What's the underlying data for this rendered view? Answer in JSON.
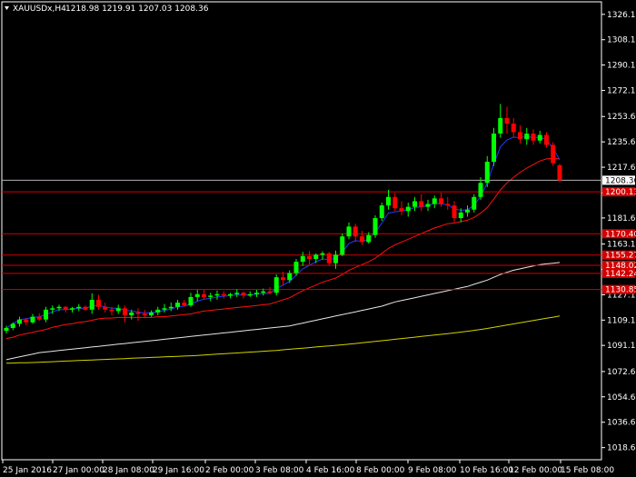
{
  "header": {
    "symbol": "XAUUSDx,H4",
    "ohlc": "1218.98 1219.91 1207.03 1208.36"
  },
  "colors": {
    "background": "#000000",
    "frame": "#ffffff",
    "bull": "#00ff00",
    "bear": "#ff0000",
    "ema_fast": "#1e3cff",
    "ema_mid": "#ff1010",
    "sma_slow": "#e6e6e6",
    "sma_vslow": "#d2d200",
    "level_line": "#d40000",
    "level_label_bg": "#d40000",
    "current_line": "#b0b0b0"
  },
  "chart_data": {
    "type": "candlestick",
    "symbol": "XAUUSDx",
    "timeframe": "H4",
    "ylim": [
      1010,
      1335
    ],
    "y_ticks": [
      "1326.10",
      "1308.10",
      "1290.15",
      "1272.10",
      "1253.60",
      "1235.60",
      "1217.60",
      "1199.55",
      "1181.60",
      "1163.10",
      "1145.15",
      "1127.10",
      "1109.10",
      "1091.15",
      "1072.60",
      "1054.65",
      "1036.60",
      "1018.60"
    ],
    "x_ticks": [
      "25 Jan 2016",
      "27 Jan 00:00",
      "28 Jan 08:00",
      "29 Jan 16:00",
      "2 Feb 00:00",
      "3 Feb 08:00",
      "4 Feb 16:00",
      "8 Feb 00:00",
      "9 Feb 08:00",
      "10 Feb 16:00",
      "12 Feb 00:00",
      "15 Feb 08:00"
    ],
    "candles": [
      [
        1101.5,
        1105,
        1099.5,
        1103.5
      ],
      [
        1103.5,
        1107.5,
        1102,
        1106.5
      ],
      [
        1106.5,
        1111.5,
        1104.5,
        1109.5
      ],
      [
        1109.5,
        1110.5,
        1105.5,
        1107.5
      ],
      [
        1107.5,
        1113.5,
        1106.5,
        1111.5
      ],
      [
        1111.5,
        1114,
        1108.5,
        1109.5
      ],
      [
        1109.5,
        1118.5,
        1107.5,
        1116.5
      ],
      [
        1116.5,
        1119.5,
        1113.5,
        1117.5
      ],
      [
        1117.5,
        1120,
        1115.5,
        1118.5
      ],
      [
        1118.5,
        1119,
        1114.5,
        1116.5
      ],
      [
        1116.5,
        1118.5,
        1114.5,
        1117.5
      ],
      [
        1117.5,
        1120.5,
        1115.5,
        1118.5
      ],
      [
        1118.5,
        1119.5,
        1115.5,
        1116.5
      ],
      [
        1116.5,
        1128,
        1113.5,
        1123.5
      ],
      [
        1123.5,
        1127,
        1116.5,
        1118.5
      ],
      [
        1118.5,
        1121.5,
        1114.5,
        1116.5
      ],
      [
        1116.5,
        1118.5,
        1112.5,
        1115.5
      ],
      [
        1115.5,
        1120,
        1113.5,
        1117.5
      ],
      [
        1117.5,
        1119.5,
        1107.5,
        1112.5
      ],
      [
        1112.5,
        1116.5,
        1109.5,
        1114.5
      ],
      [
        1114.5,
        1117.5,
        1108.5,
        1113.5
      ],
      [
        1113.5,
        1116.5,
        1110.5,
        1112.5
      ],
      [
        1112.5,
        1116,
        1111.5,
        1114.5
      ],
      [
        1114.5,
        1118.5,
        1112.5,
        1116.5
      ],
      [
        1116.5,
        1120.5,
        1114.5,
        1117.5
      ],
      [
        1117.5,
        1121.5,
        1115.5,
        1118.5
      ],
      [
        1118.5,
        1123.5,
        1116.5,
        1121.5
      ],
      [
        1121.5,
        1123.5,
        1118.5,
        1119.5
      ],
      [
        1119.5,
        1128.5,
        1118.5,
        1125.5
      ],
      [
        1125.5,
        1130.5,
        1122.5,
        1127.5
      ],
      [
        1127.5,
        1130.5,
        1123.5,
        1125.5
      ],
      [
        1125.5,
        1128.5,
        1122.5,
        1126.5
      ],
      [
        1126.5,
        1130,
        1123.5,
        1127.5
      ],
      [
        1127.5,
        1129.5,
        1124.5,
        1126.5
      ],
      [
        1126.5,
        1128.5,
        1124.5,
        1127.5
      ],
      [
        1127.5,
        1131,
        1125.5,
        1128.5
      ],
      [
        1128.5,
        1129.5,
        1124.5,
        1126.5
      ],
      [
        1126.5,
        1129.5,
        1125.5,
        1127.5
      ],
      [
        1127.5,
        1130.5,
        1125.5,
        1128.5
      ],
      [
        1128.5,
        1131.5,
        1126.5,
        1129.5
      ],
      [
        1129.5,
        1132.5,
        1127.5,
        1128.5
      ],
      [
        1128.5,
        1141.5,
        1126.5,
        1139.5
      ],
      [
        1139.5,
        1143.5,
        1133.5,
        1137.5
      ],
      [
        1137.5,
        1144.5,
        1135.5,
        1142.5
      ],
      [
        1142.5,
        1152.5,
        1140.5,
        1150.5
      ],
      [
        1150.5,
        1157.5,
        1147.5,
        1154.5
      ],
      [
        1154.5,
        1158,
        1148.5,
        1152.5
      ],
      [
        1152.5,
        1156.5,
        1149.5,
        1155.5
      ],
      [
        1155.5,
        1158,
        1152,
        1156.5
      ],
      [
        1156.5,
        1157.5,
        1147.5,
        1149.5
      ],
      [
        1149.5,
        1158.5,
        1145.5,
        1155.5
      ],
      [
        1155.5,
        1170.5,
        1154.5,
        1168.5
      ],
      [
        1168.5,
        1178.5,
        1166.5,
        1175.5
      ],
      [
        1175.5,
        1177.5,
        1164.5,
        1168.5
      ],
      [
        1168.5,
        1172.5,
        1162.5,
        1164.5
      ],
      [
        1164.5,
        1171.5,
        1163.5,
        1169.5
      ],
      [
        1169.5,
        1183.5,
        1167.5,
        1181.5
      ],
      [
        1181.5,
        1192.5,
        1179.5,
        1190.5
      ],
      [
        1190.5,
        1201.5,
        1187.5,
        1196.5
      ],
      [
        1196.5,
        1199.5,
        1186.5,
        1188.5
      ],
      [
        1188.5,
        1193.5,
        1183.5,
        1186.5
      ],
      [
        1186.5,
        1192.5,
        1182.5,
        1189.5
      ],
      [
        1189.5,
        1196.5,
        1186.5,
        1193.5
      ],
      [
        1193.5,
        1198.5,
        1186.5,
        1189.5
      ],
      [
        1189.5,
        1194.5,
        1186.5,
        1191.5
      ],
      [
        1191.5,
        1197.5,
        1188.5,
        1195.5
      ],
      [
        1195.5,
        1199.5,
        1189.5,
        1191.5
      ],
      [
        1191.5,
        1196.5,
        1187.5,
        1190.5
      ],
      [
        1190.5,
        1193.5,
        1178.5,
        1181.5
      ],
      [
        1181.5,
        1188.5,
        1178.5,
        1185.5
      ],
      [
        1185.5,
        1190.5,
        1182.5,
        1187.5
      ],
      [
        1187.5,
        1198.5,
        1185.5,
        1196.5
      ],
      [
        1196.5,
        1210.5,
        1194.5,
        1206.5
      ],
      [
        1206.5,
        1225.5,
        1203.5,
        1221.5
      ],
      [
        1221.5,
        1245.5,
        1218.5,
        1241.5
      ],
      [
        1241.5,
        1262.5,
        1238.5,
        1252.5
      ],
      [
        1252.5,
        1260.5,
        1241.5,
        1248.5
      ],
      [
        1248.5,
        1252.5,
        1238.5,
        1242.5
      ],
      [
        1242.5,
        1247.5,
        1234.5,
        1237.5
      ],
      [
        1237.5,
        1245.5,
        1233.5,
        1241.5
      ],
      [
        1241.5,
        1244.5,
        1233.5,
        1236.5
      ],
      [
        1236.5,
        1243.5,
        1234.5,
        1240.5
      ],
      [
        1240.5,
        1242.5,
        1231.5,
        1233.5
      ],
      [
        1233.5,
        1235.5,
        1218.5,
        1220.5
      ],
      [
        1218.98,
        1219.91,
        1207.03,
        1208.36
      ]
    ],
    "horizontal_levels": [
      {
        "value": 1200.13,
        "label": "1200.13"
      },
      {
        "value": 1170.4,
        "label": "1170.40"
      },
      {
        "value": 1155.27,
        "label": "1155.27"
      },
      {
        "value": 1148.02,
        "label": "1148.02"
      },
      {
        "value": 1142.24,
        "label": "1142.24"
      },
      {
        "value": 1130.85,
        "label": "1130.85"
      }
    ],
    "current_price": {
      "value": 1208.36,
      "label": "1208.36"
    },
    "ema_fast": [
      1103.5,
      1106.5,
      1109.5,
      1110.0,
      1111.0,
      1111.5,
      1113.0,
      1115.0,
      1116.5,
      1116.5,
      1117.0,
      1117.5,
      1117.5,
      1119.0,
      1119.5,
      1118.5,
      1117.5,
      1117.5,
      1116.0,
      1115.5,
      1115.0,
      1114.0,
      1114.5,
      1115.0,
      1116.0,
      1117.0,
      1118.5,
      1119.0,
      1120.5,
      1122.5,
      1124.0,
      1124.5,
      1125.5,
      1126.0,
      1126.5,
      1127.0,
      1127.0,
      1127.0,
      1127.5,
      1128.0,
      1128.0,
      1131.5,
      1134.0,
      1136.5,
      1141.0,
      1145.5,
      1148.0,
      1150.5,
      1152.5,
      1152.0,
      1153.0,
      1157.5,
      1163.5,
      1165.5,
      1165.0,
      1166.5,
      1171.5,
      1178.0,
      1185.0,
      1186.0,
      1186.5,
      1187.5,
      1189.0,
      1189.5,
      1190.5,
      1192.0,
      1191.5,
      1191.0,
      1188.0,
      1187.0,
      1187.5,
      1190.5,
      1197.0,
      1206.5,
      1220.0,
      1232.0,
      1237.0,
      1239.0,
      1238.5,
      1239.5,
      1238.5,
      1239.0,
      1237.0,
      1231.0,
      1223.0
    ],
    "ema_mid": [
      1096.0,
      1097.0,
      1098.5,
      1099.5,
      1100.5,
      1101.5,
      1102.5,
      1104.0,
      1105.0,
      1106.0,
      1106.5,
      1107.5,
      1108.0,
      1109.0,
      1110.0,
      1110.5,
      1110.5,
      1111.0,
      1111.0,
      1111.0,
      1111.0,
      1111.0,
      1111.0,
      1111.5,
      1111.5,
      1112.0,
      1112.5,
      1113.0,
      1113.5,
      1114.5,
      1115.5,
      1116.0,
      1116.5,
      1117.0,
      1117.5,
      1118.0,
      1118.5,
      1119.0,
      1119.5,
      1120.0,
      1120.5,
      1122.0,
      1123.5,
      1125.0,
      1127.5,
      1130.0,
      1132.0,
      1134.0,
      1136.0,
      1137.5,
      1139.0,
      1141.5,
      1144.5,
      1146.5,
      1148.5,
      1150.5,
      1153.0,
      1156.5,
      1160.0,
      1162.5,
      1164.5,
      1166.5,
      1168.5,
      1170.5,
      1172.5,
      1174.5,
      1176.0,
      1177.5,
      1178.0,
      1179.0,
      1180.0,
      1182.0,
      1185.0,
      1189.0,
      1195.0,
      1201.5,
      1206.5,
      1210.5,
      1214.0,
      1217.0,
      1219.5,
      1222.0,
      1223.5,
      1224.0,
      1223.5
    ],
    "sma_slow": [
      1081.0,
      1082.0,
      1083.0,
      1084.0,
      1085.0,
      1086.0,
      1086.5,
      1087.0,
      1087.5,
      1088.0,
      1088.5,
      1089.0,
      1089.5,
      1090.0,
      1090.5,
      1091.0,
      1091.5,
      1092.0,
      1092.5,
      1093.0,
      1093.5,
      1094.0,
      1094.5,
      1095.0,
      1095.5,
      1096.0,
      1096.5,
      1097.0,
      1097.5,
      1098.0,
      1098.5,
      1099.0,
      1099.5,
      1100.0,
      1100.5,
      1101.0,
      1101.5,
      1102.0,
      1102.5,
      1103.0,
      1103.5,
      1104.0,
      1104.5,
      1105.0,
      1106.0,
      1107.0,
      1108.0,
      1109.0,
      1110.0,
      1111.0,
      1112.0,
      1113.0,
      1114.0,
      1115.0,
      1116.0,
      1117.0,
      1118.0,
      1119.0,
      1120.5,
      1122.0,
      1123.0,
      1124.0,
      1125.0,
      1126.0,
      1127.0,
      1128.0,
      1129.0,
      1130.0,
      1131.0,
      1132.0,
      1133.0,
      1134.5,
      1136.0,
      1137.5,
      1139.5,
      1141.5,
      1143.0,
      1144.5,
      1145.5,
      1146.5,
      1147.5,
      1148.5,
      1149.0,
      1149.5,
      1150.0
    ],
    "sma_vslow": [
      1078.5,
      1078.6,
      1078.8,
      1078.9,
      1079.0,
      1079.2,
      1079.4,
      1079.6,
      1079.8,
      1080.0,
      1080.2,
      1080.4,
      1080.6,
      1080.8,
      1081.0,
      1081.2,
      1081.4,
      1081.6,
      1081.8,
      1082.0,
      1082.2,
      1082.4,
      1082.6,
      1082.8,
      1083.0,
      1083.2,
      1083.4,
      1083.6,
      1083.8,
      1084.0,
      1084.3,
      1084.6,
      1084.9,
      1085.2,
      1085.5,
      1085.8,
      1086.1,
      1086.4,
      1086.7,
      1087.0,
      1087.3,
      1087.6,
      1088.0,
      1088.4,
      1088.8,
      1089.2,
      1089.6,
      1090.0,
      1090.4,
      1090.8,
      1091.2,
      1091.6,
      1092.0,
      1092.5,
      1093.0,
      1093.5,
      1094.0,
      1094.5,
      1095.0,
      1095.5,
      1096.0,
      1096.5,
      1097.0,
      1097.5,
      1098.0,
      1098.5,
      1099.0,
      1099.5,
      1100.0,
      1100.6,
      1101.2,
      1101.8,
      1102.5,
      1103.2,
      1104.0,
      1104.8,
      1105.6,
      1106.4,
      1107.2,
      1108.0,
      1108.8,
      1109.6,
      1110.4,
      1111.2,
      1112.0
    ]
  }
}
